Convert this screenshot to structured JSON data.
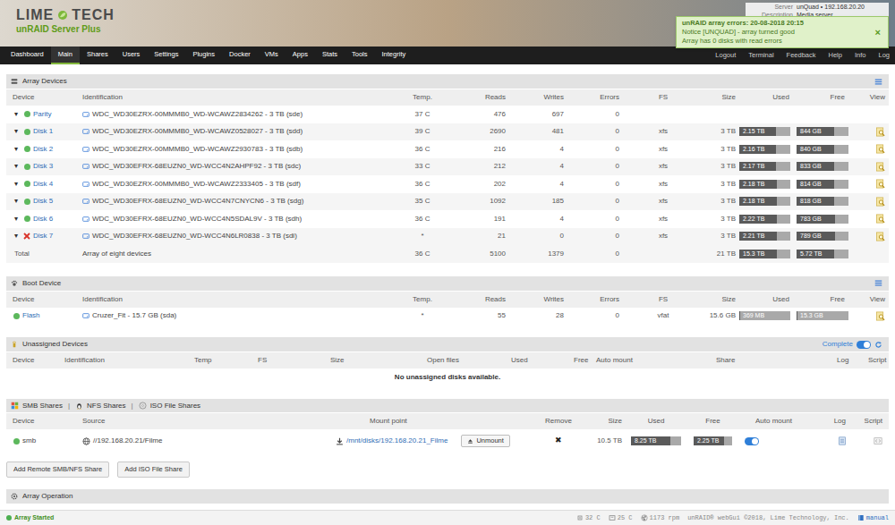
{
  "header": {
    "logo": [
      "LIME",
      "TECH"
    ],
    "subtitle": "unRAID Server Plus",
    "info": [
      {
        "label": "Server",
        "value": "unQuad • 192.168.20.20"
      },
      {
        "label": "Description",
        "value": "Media server"
      }
    ]
  },
  "notification": {
    "title": "unRAID array errors: 20-08-2018 20:15",
    "lines": [
      "Notice [UNQUAD] - array turned good",
      "Array has 0 disks with read errors"
    ],
    "close": "×"
  },
  "nav": {
    "items": [
      {
        "label": "Dashboard",
        "selected": false
      },
      {
        "label": "Main",
        "selected": true
      },
      {
        "label": "Shares",
        "selected": false
      },
      {
        "label": "Users",
        "selected": false
      },
      {
        "label": "Settings",
        "selected": false
      },
      {
        "label": "Plugins",
        "selected": false
      },
      {
        "label": "Docker",
        "selected": false
      },
      {
        "label": "VMs",
        "selected": false
      },
      {
        "label": "Apps",
        "selected": false
      },
      {
        "label": "Stats",
        "selected": false
      },
      {
        "label": "Tools",
        "selected": false
      },
      {
        "label": "Integrity",
        "selected": false
      }
    ],
    "right": [
      "Logout",
      "Terminal",
      "Feedback",
      "Help",
      "Info",
      "Log"
    ]
  },
  "array": {
    "title": "Array Devices",
    "columns": [
      "Device",
      "Identification",
      "Temp.",
      "Reads",
      "Writes",
      "Errors",
      "FS",
      "Size",
      "Used",
      "Free",
      "View"
    ],
    "rows": [
      {
        "expander": "▾",
        "status": {
          "kind": "dot",
          "color": "#5cb85c"
        },
        "device": "Parity",
        "id": "WDC_WD30EZRX-00MMMB0_WD-WCAWZ2834262 - 3 TB (sde)",
        "temp": "37 C",
        "reads": "476",
        "writes": "697",
        "errors": "0",
        "view": false
      },
      {
        "expander": "▾",
        "status": {
          "kind": "dot",
          "color": "#5cb85c"
        },
        "device": "Disk 1",
        "id": "WDC_WD30EZRX-00MMMB0_WD-WCAWZ0528027 - 3 TB (sdd)",
        "temp": "39 C",
        "reads": "2690",
        "writes": "481",
        "errors": "0",
        "fs": "xfs",
        "size": "3 TB",
        "used": "2.15 TB",
        "free": "844 GB",
        "level": 0.72,
        "view": true
      },
      {
        "expander": "▾",
        "status": {
          "kind": "dot",
          "color": "#5cb85c"
        },
        "device": "Disk 2",
        "id": "WDC_WD30EZRX-00MMMB0_WD-WCAWZ2930783 - 3 TB (sdb)",
        "temp": "36 C",
        "reads": "216",
        "writes": "4",
        "errors": "0",
        "fs": "xfs",
        "size": "3 TB",
        "used": "2.16 TB",
        "free": "840 GB",
        "level": 0.72,
        "view": true
      },
      {
        "expander": "▾",
        "status": {
          "kind": "dot",
          "color": "#5cb85c"
        },
        "device": "Disk 3",
        "id": "WDC_WD30EFRX-68EUZN0_WD-WCC4N2AHPF92 - 3 TB (sdc)",
        "temp": "33 C",
        "reads": "212",
        "writes": "4",
        "errors": "0",
        "fs": "xfs",
        "size": "3 TB",
        "used": "2.17 TB",
        "free": "833 GB",
        "level": 0.72,
        "view": true
      },
      {
        "expander": "▾",
        "status": {
          "kind": "dot",
          "color": "#5cb85c"
        },
        "device": "Disk 4",
        "id": "WDC_WD30EZRX-00MMMB0_WD-WCAWZ2333405 - 3 TB (sdf)",
        "temp": "36 C",
        "reads": "202",
        "writes": "4",
        "errors": "0",
        "fs": "xfs",
        "size": "3 TB",
        "used": "2.18 TB",
        "free": "814 GB",
        "level": 0.73,
        "view": true
      },
      {
        "expander": "▾",
        "status": {
          "kind": "dot",
          "color": "#5cb85c"
        },
        "device": "Disk 5",
        "id": "WDC_WD30EFRX-68EUZN0_WD-WCC4N7CNYCN6 - 3 TB (sdg)",
        "temp": "35 C",
        "reads": "1092",
        "writes": "185",
        "errors": "0",
        "fs": "xfs",
        "size": "3 TB",
        "used": "2.18 TB",
        "free": "818 GB",
        "level": 0.73,
        "view": true
      },
      {
        "expander": "▾",
        "status": {
          "kind": "dot",
          "color": "#5cb85c"
        },
        "device": "Disk 6",
        "id": "WDC_WD30EFRX-68EUZN0_WD-WCC4N5SDAL9V - 3 TB (sdh)",
        "temp": "36 C",
        "reads": "191",
        "writes": "4",
        "errors": "0",
        "fs": "xfs",
        "size": "3 TB",
        "used": "2.22 TB",
        "free": "783 GB",
        "level": 0.74,
        "view": true
      },
      {
        "expander": "▾",
        "status": {
          "kind": "cross",
          "color": "#d9342b"
        },
        "device": "Disk 7",
        "id": "WDC_WD30EFRX-68EUZN0_WD-WCC4N6LR0838 - 3 TB (sdi)",
        "temp": "*",
        "reads": "21",
        "writes": "0",
        "errors": "0",
        "fs": "xfs",
        "size": "3 TB",
        "used": "2.21 TB",
        "free": "789 GB",
        "level": 0.74,
        "view": true
      }
    ],
    "total": {
      "device": "Total",
      "id": "Array of eight devices",
      "temp": "36 C",
      "reads": "5100",
      "writes": "1379",
      "errors": "0",
      "size": "21 TB",
      "used": "15.3 TB",
      "free": "5.72 TB",
      "level": 0.73
    }
  },
  "boot": {
    "title": "Boot Device",
    "columns": [
      "Device",
      "Identification",
      "Temp.",
      "Reads",
      "Writes",
      "Errors",
      "FS",
      "Size",
      "Used",
      "Free",
      "View"
    ],
    "rows": [
      {
        "status": {
          "kind": "dot",
          "color": "#5cb85c"
        },
        "device": "Flash",
        "id": "Cruzer_Fit - 15.7 GB (sda)",
        "temp": "*",
        "reads": "55",
        "writes": "28",
        "errors": "0",
        "fs": "vfat",
        "size": "15.6 GB",
        "used": "369 MB",
        "free": "15.3 GB",
        "level": 0.02,
        "view": true
      }
    ]
  },
  "unassigned": {
    "title": "Unassigned Devices",
    "toggle_label": "Complete",
    "toggle_on": true,
    "columns": [
      "Device",
      "Identification",
      "Temp",
      "FS",
      "Size",
      "Open files",
      "Used",
      "Free",
      "Auto mount",
      "Share",
      "Log",
      "Script"
    ],
    "empty": "No unassigned disks available."
  },
  "shares": {
    "tabs": [
      "SMB Shares",
      "NFS Shares",
      "ISO File Shares"
    ],
    "separator": "|",
    "columns": [
      "Device",
      "Source",
      "Mount point",
      "Remove",
      "Size",
      "Used",
      "Free",
      "Auto mount",
      "Log",
      "Script"
    ],
    "rows": [
      {
        "status": {
          "kind": "dot",
          "color": "#5cb85c"
        },
        "device": "smb",
        "source": "//192.168.20.21/Filme",
        "mount": "/mnt/disks/192.168.20.21_Filme",
        "button": "Unmount",
        "remove": "✖",
        "size": "10.5 TB",
        "used": "8.25 TB",
        "free": "2.25 TB",
        "level": 0.79,
        "auto_mount": true
      }
    ],
    "buttons": [
      "Add Remote SMB/NFS Share",
      "Add ISO File Share"
    ]
  },
  "operation": {
    "title": "Array Operation"
  },
  "footer": {
    "status": "Array Started",
    "readings": [
      {
        "kind": "cpu",
        "text": "32 C"
      },
      {
        "kind": "board",
        "text": "25 C"
      },
      {
        "kind": "fan",
        "text": "1173 rpm"
      }
    ],
    "copyright": "unRAID® webGui ©2018, Lime Technology, Inc.",
    "manual": "manual"
  }
}
